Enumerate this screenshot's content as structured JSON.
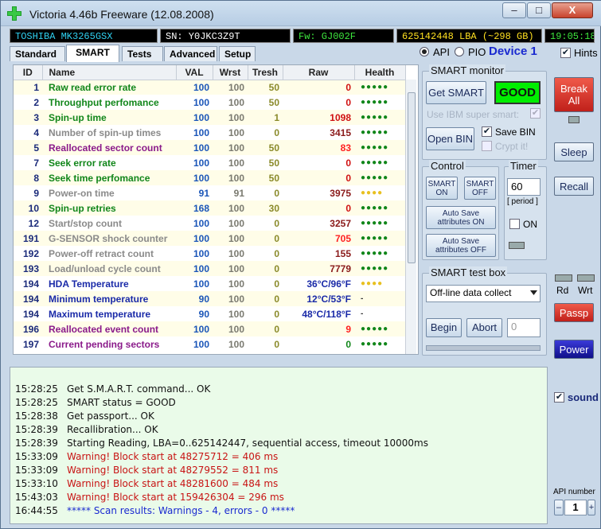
{
  "window": {
    "title": "Victoria 4.46b Freeware (12.08.2008)",
    "minimize": "–",
    "maximize": "□",
    "close": "X"
  },
  "infobar": {
    "model": "TOSHIBA MK3265GSX",
    "serial": "SN: Y0JKC3Z9T",
    "firmware": "Fw: GJ002F",
    "lba": "625142448 LBA (~298 GB)",
    "time": "19:05:18",
    "colors": {
      "model": "#2fd0f0",
      "serial": "#ffffff",
      "firmware": "#3ee83e",
      "lba": "#ffe020",
      "time": "#3ee83e"
    }
  },
  "tabs": [
    "Standard",
    "SMART",
    "Tests",
    "Advanced",
    "Setup"
  ],
  "active_tab": "SMART",
  "mode": {
    "api_label": "API",
    "pio_label": "PIO",
    "selected": "API",
    "device": "Device 1",
    "hints_label": "Hints"
  },
  "smart_table": {
    "headers": [
      "ID",
      "Name",
      "VAL",
      "Wrst",
      "Tresh",
      "Raw",
      "Health"
    ],
    "rows": [
      {
        "id": "1",
        "name": "Raw read error rate",
        "val": "100",
        "wrst": "100",
        "tresh": "50",
        "raw": "0",
        "health": "●●●●●",
        "name_color": "#11861a",
        "raw_color": "#d01010",
        "health_color": "#11861a"
      },
      {
        "id": "2",
        "name": "Throughput perfomance",
        "val": "100",
        "wrst": "100",
        "tresh": "50",
        "raw": "0",
        "health": "●●●●●",
        "name_color": "#11861a",
        "raw_color": "#d01010",
        "health_color": "#11861a"
      },
      {
        "id": "3",
        "name": "Spin-up time",
        "val": "100",
        "wrst": "100",
        "tresh": "1",
        "raw": "1098",
        "health": "●●●●●",
        "name_color": "#11861a",
        "raw_color": "#d01010",
        "health_color": "#11861a"
      },
      {
        "id": "4",
        "name": "Number of spin-up times",
        "val": "100",
        "wrst": "100",
        "tresh": "0",
        "raw": "3415",
        "health": "●●●●●",
        "name_color": "#8a8a8a",
        "raw_color": "#8a1a1a",
        "health_color": "#11861a"
      },
      {
        "id": "5",
        "name": "Reallocated sector count",
        "val": "100",
        "wrst": "100",
        "tresh": "50",
        "raw": "83",
        "health": "●●●●●",
        "name_color": "#8a1a8a",
        "raw_color": "#ff2020",
        "health_color": "#11861a"
      },
      {
        "id": "7",
        "name": "Seek error rate",
        "val": "100",
        "wrst": "100",
        "tresh": "50",
        "raw": "0",
        "health": "●●●●●",
        "name_color": "#11861a",
        "raw_color": "#d01010",
        "health_color": "#11861a"
      },
      {
        "id": "8",
        "name": "Seek time perfomance",
        "val": "100",
        "wrst": "100",
        "tresh": "50",
        "raw": "0",
        "health": "●●●●●",
        "name_color": "#11861a",
        "raw_color": "#d01010",
        "health_color": "#11861a"
      },
      {
        "id": "9",
        "name": "Power-on time",
        "val": "91",
        "wrst": "91",
        "tresh": "0",
        "raw": "3975",
        "health": "●●●●",
        "name_color": "#8a8a8a",
        "raw_color": "#8a1a1a",
        "health_color": "#e8c020"
      },
      {
        "id": "10",
        "name": "Spin-up retries",
        "val": "168",
        "wrst": "100",
        "tresh": "30",
        "raw": "0",
        "health": "●●●●●",
        "name_color": "#11861a",
        "raw_color": "#d01010",
        "health_color": "#11861a"
      },
      {
        "id": "12",
        "name": "Start/stop count",
        "val": "100",
        "wrst": "100",
        "tresh": "0",
        "raw": "3257",
        "health": "●●●●●",
        "name_color": "#8a8a8a",
        "raw_color": "#8a1a1a",
        "health_color": "#11861a"
      },
      {
        "id": "191",
        "name": "G-SENSOR shock counter",
        "val": "100",
        "wrst": "100",
        "tresh": "0",
        "raw": "705",
        "health": "●●●●●",
        "name_color": "#8a8a8a",
        "raw_color": "#ff2020",
        "health_color": "#11861a"
      },
      {
        "id": "192",
        "name": "Power-off retract count",
        "val": "100",
        "wrst": "100",
        "tresh": "0",
        "raw": "155",
        "health": "●●●●●",
        "name_color": "#8a8a8a",
        "raw_color": "#8a1a1a",
        "health_color": "#11861a"
      },
      {
        "id": "193",
        "name": "Load/unload cycle count",
        "val": "100",
        "wrst": "100",
        "tresh": "0",
        "raw": "7779",
        "health": "●●●●●",
        "name_color": "#8a8a8a",
        "raw_color": "#8a1a1a",
        "health_color": "#11861a"
      },
      {
        "id": "194",
        "name": "HDA Temperature",
        "val": "100",
        "wrst": "100",
        "tresh": "0",
        "raw": "36°C/96°F",
        "health": "●●●●",
        "name_color": "#1a2aa8",
        "raw_color": "#1a2aa8",
        "health_color": "#e8c020"
      },
      {
        "id": "194",
        "name": "Minimum temperature",
        "val": "90",
        "wrst": "100",
        "tresh": "0",
        "raw": "12°C/53°F",
        "health": "-",
        "name_color": "#1a2aa8",
        "raw_color": "#1a2aa8",
        "health_color": "#333"
      },
      {
        "id": "194",
        "name": "Maximum temperature",
        "val": "90",
        "wrst": "100",
        "tresh": "0",
        "raw": "48°C/118°F",
        "health": "-",
        "name_color": "#1a2aa8",
        "raw_color": "#1a2aa8",
        "health_color": "#333"
      },
      {
        "id": "196",
        "name": "Reallocated event count",
        "val": "100",
        "wrst": "100",
        "tresh": "0",
        "raw": "9",
        "health": "●●●●●",
        "name_color": "#8a1a8a",
        "raw_color": "#ff2020",
        "health_color": "#11861a"
      },
      {
        "id": "197",
        "name": "Current pending sectors",
        "val": "100",
        "wrst": "100",
        "tresh": "0",
        "raw": "0",
        "health": "●●●●●",
        "name_color": "#8a1a8a",
        "raw_color": "#11861a",
        "health_color": "#11861a"
      }
    ]
  },
  "smart_monitor": {
    "label": "SMART monitor",
    "get_smart": "Get SMART",
    "status": "GOOD",
    "status_color": "#00ee00",
    "ibm_label": "Use IBM super smart:",
    "open_bin": "Open BIN",
    "save_bin": "Save BIN",
    "crypt": "Crypt it!"
  },
  "control": {
    "label": "Control",
    "smart_on": "SMART ON",
    "smart_off": "SMART OFF",
    "autosave_on": "Auto Save attributes ON",
    "autosave_off": "Auto Save attributes OFF"
  },
  "timer": {
    "label": "Timer",
    "value": "60",
    "period": "[ period ]",
    "on_label": "ON"
  },
  "test_box": {
    "label": "SMART test box",
    "selected": "Off-line data collect",
    "begin": "Begin",
    "abort": "Abort",
    "value": "0"
  },
  "right_panel": {
    "break_all": "Break All",
    "sleep": "Sleep",
    "recall": "Recall",
    "rd": "Rd",
    "wrt": "Wrt",
    "passp": "Passp",
    "power": "Power",
    "sound": "sound",
    "api_number_label": "API number",
    "api_number": "1",
    "minus": "–",
    "plus": "+"
  },
  "log": [
    {
      "time": "15:28:25",
      "text": "Get S.M.A.R.T. command... OK",
      "color": "#111111"
    },
    {
      "time": "15:28:25",
      "text": "SMART status = GOOD",
      "color": "#111111"
    },
    {
      "time": "15:28:38",
      "text": "Get passport... OK",
      "color": "#111111"
    },
    {
      "time": "15:28:39",
      "text": "Recallibration... OK",
      "color": "#111111"
    },
    {
      "time": "15:28:39",
      "text": "Starting Reading, LBA=0..625142447, sequential access, timeout 10000ms",
      "color": "#111111"
    },
    {
      "time": "15:33:09",
      "text": "Warning! Block start at 48275712 = 406 ms",
      "color": "#c81414"
    },
    {
      "time": "15:33:09",
      "text": "Warning! Block start at 48279552 = 811 ms",
      "color": "#c81414"
    },
    {
      "time": "15:33:10",
      "text": "Warning! Block start at 48281600 = 484 ms",
      "color": "#c81414"
    },
    {
      "time": "15:43:03",
      "text": "Warning! Block start at 159426304 = 296 ms",
      "color": "#c81414"
    },
    {
      "time": "16:44:55",
      "text": "***** Scan results: Warnings - 4, errors - 0 *****",
      "color": "#1a2ad0"
    }
  ]
}
